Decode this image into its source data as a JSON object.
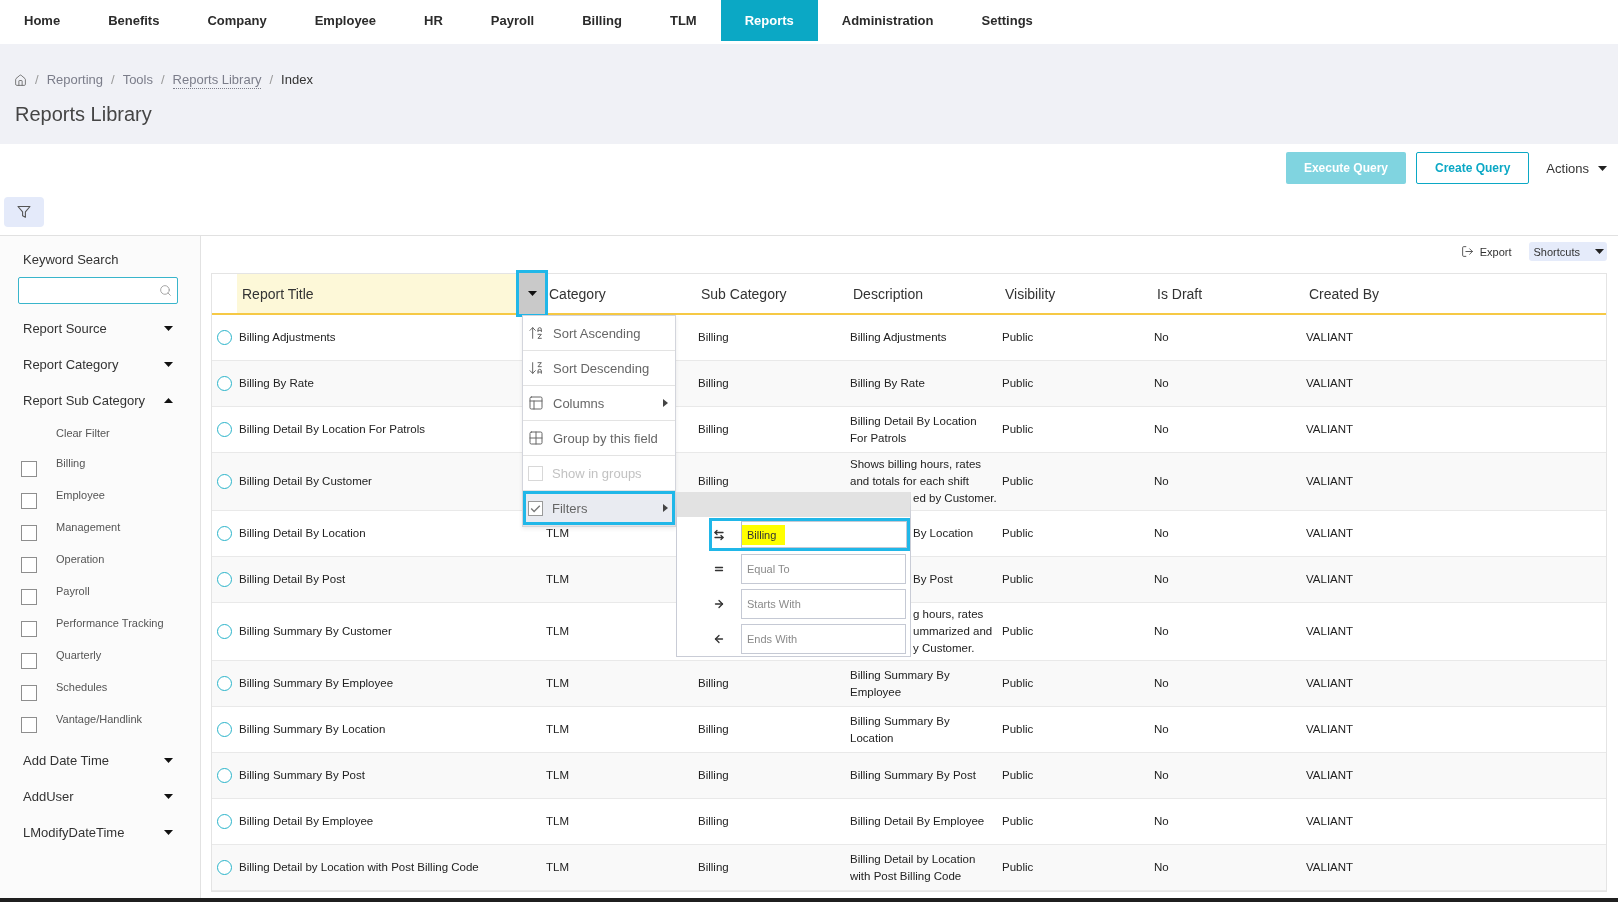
{
  "nav": {
    "tabs": [
      {
        "label": "Home",
        "selected": false
      },
      {
        "label": "Benefits",
        "selected": false
      },
      {
        "label": "Company",
        "selected": false
      },
      {
        "label": "Employee",
        "selected": false
      },
      {
        "label": "HR",
        "selected": false
      },
      {
        "label": "Payroll",
        "selected": false
      },
      {
        "label": "Billing",
        "selected": false
      },
      {
        "label": "TLM",
        "selected": false
      },
      {
        "label": "Reports",
        "selected": true
      },
      {
        "label": "Administration",
        "selected": false
      },
      {
        "label": "Settings",
        "selected": false
      }
    ]
  },
  "breadcrumb": [
    {
      "kind": "home"
    },
    {
      "kind": "link",
      "separator": "/",
      "label": "Reporting"
    },
    {
      "kind": "link",
      "separator": "/",
      "label": "Tools"
    },
    {
      "kind": "dotted",
      "separator": "/",
      "label": "Reports Library"
    },
    {
      "kind": "current",
      "separator": "/",
      "label": "Index"
    }
  ],
  "page_title": "Reports Library",
  "header_actions": [
    {
      "label": "Execute Query",
      "kind": "primary",
      "disabled": true
    },
    {
      "label": "Create Query",
      "kind": "outline",
      "disabled": false
    },
    {
      "label": "Actions",
      "kind": "dropdown",
      "disabled": false
    }
  ],
  "sidebar": {
    "search_label": "Keyword Search",
    "sections": [
      {
        "label": "Report Source",
        "expanded": false
      },
      {
        "label": "Report Category",
        "expanded": false
      },
      {
        "label": "Report Sub Category",
        "expanded": true,
        "clear_filter": "Clear Filter",
        "options": [
          {
            "label": "Billing",
            "checked": false
          },
          {
            "label": "Employee",
            "checked": false
          },
          {
            "label": "Management",
            "checked": false
          },
          {
            "label": "Operation",
            "checked": false
          },
          {
            "label": "Payroll",
            "checked": false
          },
          {
            "label": "Performance Tracking",
            "checked": false
          },
          {
            "label": "Quarterly",
            "checked": false
          },
          {
            "label": "Schedules",
            "checked": false
          },
          {
            "label": "Vantage/Handlink",
            "checked": false
          }
        ]
      },
      {
        "label": "Add Date Time",
        "expanded": false
      },
      {
        "label": "AddUser",
        "expanded": false
      },
      {
        "label": "LModifyDateTime",
        "expanded": false
      }
    ]
  },
  "grid_toolbar": {
    "export": "Export",
    "shortcuts": "Shortcuts"
  },
  "table": {
    "columns": [
      {
        "label": "Report Title",
        "active": true
      },
      {
        "label": "Category",
        "active": false
      },
      {
        "label": "Sub Category",
        "active": false
      },
      {
        "label": "Description",
        "active": false
      },
      {
        "label": "Visibility",
        "active": false
      },
      {
        "label": "Is Draft",
        "active": false
      },
      {
        "label": "Created By",
        "active": false
      }
    ],
    "rows": [
      {
        "selected": false,
        "title": "Billing Adjustments",
        "sub_category": "Billing",
        "description": [
          "Billing Adjustments"
        ],
        "visibility": "Public",
        "is_draft": "No",
        "created_by": "VALIANT"
      },
      {
        "selected": false,
        "title": "Billing By Rate",
        "sub_category": "Billing",
        "description": [
          "Billing By Rate"
        ],
        "visibility": "Public",
        "is_draft": "No",
        "created_by": "VALIANT"
      },
      {
        "selected": false,
        "title": "Billing Detail By Location For Patrols",
        "sub_category": "Billing",
        "description": [
          "Billing Detail By Location",
          "For Patrols"
        ],
        "visibility": "Public",
        "is_draft": "No",
        "created_by": "VALIANT"
      },
      {
        "selected": false,
        "title": "Billing Detail By Customer",
        "sub_category": "Billing",
        "description": [
          "Shows billing hours, rates",
          "and totals for each shift"
        ],
        "description_tail": [
          "ed by Customer."
        ],
        "visibility": "Public",
        "is_draft": "No",
        "created_by": "VALIANT"
      },
      {
        "selected": false,
        "title": "Billing Detail By Location",
        "category": "TLM",
        "description_tail": [
          "By Location"
        ],
        "visibility": "Public",
        "is_draft": "No",
        "created_by": "VALIANT"
      },
      {
        "selected": false,
        "title": "Billing Detail By Post",
        "category": "TLM",
        "description_tail": [
          "By Post"
        ],
        "visibility": "Public",
        "is_draft": "No",
        "created_by": "VALIANT"
      },
      {
        "selected": false,
        "title": "Billing Summary By Customer",
        "category": "TLM",
        "description_tail": [
          "g hours, rates",
          "ummarized and",
          "y Customer."
        ],
        "visibility": "Public",
        "is_draft": "No",
        "created_by": "VALIANT"
      },
      {
        "selected": false,
        "title": "Billing Summary By Employee",
        "category": "TLM",
        "sub_category": "Billing",
        "description": [
          "Billing Summary By",
          "Employee"
        ],
        "visibility": "Public",
        "is_draft": "No",
        "created_by": "VALIANT"
      },
      {
        "selected": false,
        "title": "Billing Summary By Location",
        "category": "TLM",
        "sub_category": "Billing",
        "description": [
          "Billing Summary By",
          "Location"
        ],
        "visibility": "Public",
        "is_draft": "No",
        "created_by": "VALIANT"
      },
      {
        "selected": false,
        "title": "Billing Summary By Post",
        "category": "TLM",
        "sub_category": "Billing",
        "description": [
          "Billing Summary By Post"
        ],
        "visibility": "Public",
        "is_draft": "No",
        "created_by": "VALIANT"
      },
      {
        "selected": false,
        "title": "Billing Detail By Employee",
        "category": "TLM",
        "sub_category": "Billing",
        "description": [
          "Billing Detail By Employee"
        ],
        "visibility": "Public",
        "is_draft": "No",
        "created_by": "VALIANT"
      },
      {
        "selected": false,
        "title": "Billing Detail by Location with Post Billing Code",
        "category": "TLM",
        "sub_category": "Billing",
        "description": [
          "Billing Detail by Location",
          "with Post Billing Code"
        ],
        "visibility": "Public",
        "is_draft": "No",
        "created_by": "VALIANT"
      }
    ]
  },
  "column_menu": {
    "trigger_highlighted": true,
    "items": [
      {
        "label": "Sort Ascending",
        "kind": "sort_ascending",
        "disabled": false,
        "highlighted": false,
        "submenu": false,
        "expanded": false
      },
      {
        "label": "Sort Descending",
        "kind": "sort_descending",
        "disabled": false,
        "highlighted": false,
        "submenu": false,
        "expanded": false
      },
      {
        "label": "Columns",
        "kind": "columns",
        "disabled": false,
        "highlighted": false,
        "submenu": true,
        "expanded": false
      },
      {
        "label": "Group by this field",
        "kind": "group",
        "disabled": false,
        "highlighted": false,
        "submenu": false,
        "expanded": false
      },
      {
        "label": "Show in groups",
        "kind": "checkbox",
        "checked": false,
        "disabled": true,
        "highlighted": false,
        "submenu": false,
        "expanded": false
      },
      {
        "label": "Filters",
        "kind": "checkbox",
        "checked": true,
        "disabled": false,
        "highlighted": true,
        "submenu": true,
        "expanded": true
      }
    ],
    "filters": [
      {
        "kind": "contains",
        "value": "Billing",
        "highlighted": true
      },
      {
        "kind": "equals",
        "placeholder": "Equal To",
        "highlighted": false
      },
      {
        "kind": "starts_with",
        "placeholder": "Starts With",
        "highlighted": false
      },
      {
        "kind": "ends_with",
        "placeholder": "Ends With",
        "highlighted": false
      }
    ]
  }
}
